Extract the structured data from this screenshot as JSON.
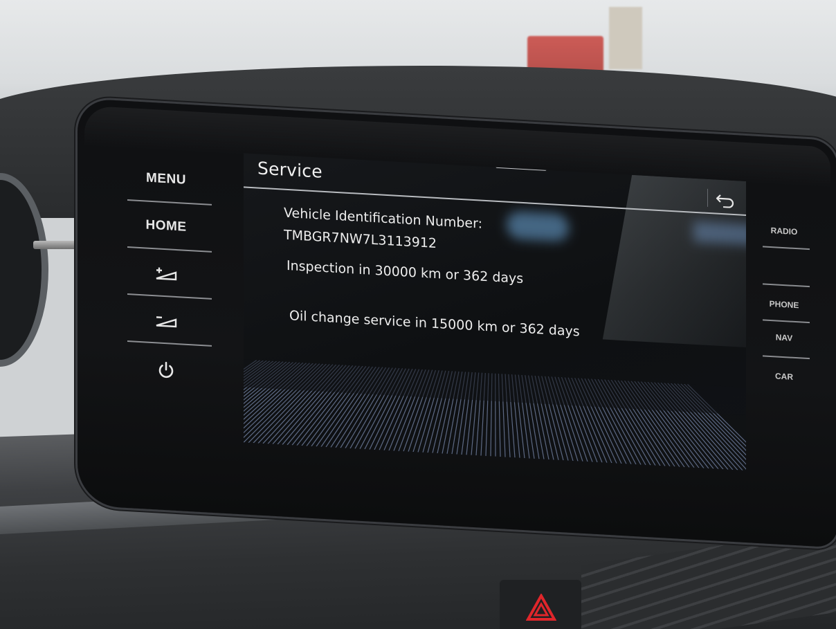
{
  "hardkeys_left": {
    "menu_label": "MENU",
    "home_label": "HOME",
    "volume_up_icon": "volume-up-icon",
    "volume_down_icon": "volume-down-icon",
    "power_icon": "power-icon"
  },
  "hardkeys_right": {
    "radio_label": "RADIO",
    "phone_label": "PHONE",
    "nav_label": "NAV",
    "car_label": "CAR"
  },
  "screen": {
    "title": "Service",
    "back_icon": "back-arrow-icon",
    "vin_label": "Vehicle Identification Number:",
    "vin_value": "TMBGR7NW7L3113912",
    "inspection_text": "Inspection in 30000 km or 362 days",
    "oil_service_text": "Oil change service in 15000 km or 362 days"
  },
  "colors": {
    "hazard": "#e0262b",
    "screen_text": "#ededed"
  }
}
